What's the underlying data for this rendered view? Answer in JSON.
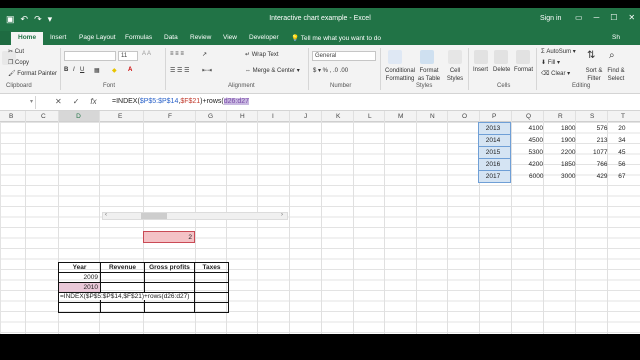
{
  "window": {
    "title": "Interactive chart example - Excel",
    "signin": "Sign in"
  },
  "tabs": [
    "Home",
    "Insert",
    "Page Layout",
    "Formulas",
    "Data",
    "Review",
    "View",
    "Developer"
  ],
  "tellme": "Tell me what you want to do",
  "share": "Sh",
  "ribbon": {
    "clipboard": {
      "cut": "Cut",
      "copy": "Copy",
      "format_painter": "Format Painter",
      "label": "Clipboard"
    },
    "font": {
      "size": "11",
      "label": "Font"
    },
    "alignment": {
      "wrap": "Wrap Text",
      "merge": "Merge & Center",
      "label": "Alignment"
    },
    "number": {
      "format": "General",
      "label": "Number"
    },
    "styles": {
      "cond": "Conditional Formatting",
      "table": "Format as Table",
      "cell": "Cell Styles",
      "label": "Styles"
    },
    "cells": {
      "insert": "Insert",
      "delete": "Delete",
      "format": "Format",
      "label": "Cells"
    },
    "editing": {
      "autosum": "AutoSum",
      "fill": "Fill",
      "clear": "Clear",
      "sort": "Sort & Filter",
      "find": "Find & Select",
      "label": "Editing"
    }
  },
  "formula_bar": {
    "p1": "=INDEX(",
    "p2": "$P$5:$P$14",
    "p3": ",",
    "p4": "$F$21",
    "p5": ")+rows(",
    "p6": "d26:d27"
  },
  "columns": [
    "B",
    "C",
    "D",
    "E",
    "F",
    "G",
    "H",
    "I",
    "J",
    "K",
    "L",
    "M",
    "N",
    "O",
    "P",
    "Q",
    "R",
    "S",
    "T"
  ],
  "top_table": [
    [
      "2013",
      "4100",
      "1800",
      "576",
      "20"
    ],
    [
      "2014",
      "4500",
      "1900",
      "213",
      "34"
    ],
    [
      "2015",
      "5300",
      "2200",
      "1077",
      "45"
    ],
    [
      "2016",
      "4200",
      "1850",
      "766",
      "56"
    ],
    [
      "2017",
      "6000",
      "3000",
      "429",
      "67"
    ]
  ],
  "selector_value": "2",
  "lower_table": {
    "headers": [
      "Year",
      "Revenue",
      "Gross profits",
      "Taxes"
    ],
    "rows": [
      [
        "2009",
        "",
        "",
        ""
      ],
      [
        "2010",
        "",
        "",
        ""
      ]
    ],
    "editing_formula": "=INDEX($P$5:$P$14,$F$21)+rows(d26:d27)"
  }
}
